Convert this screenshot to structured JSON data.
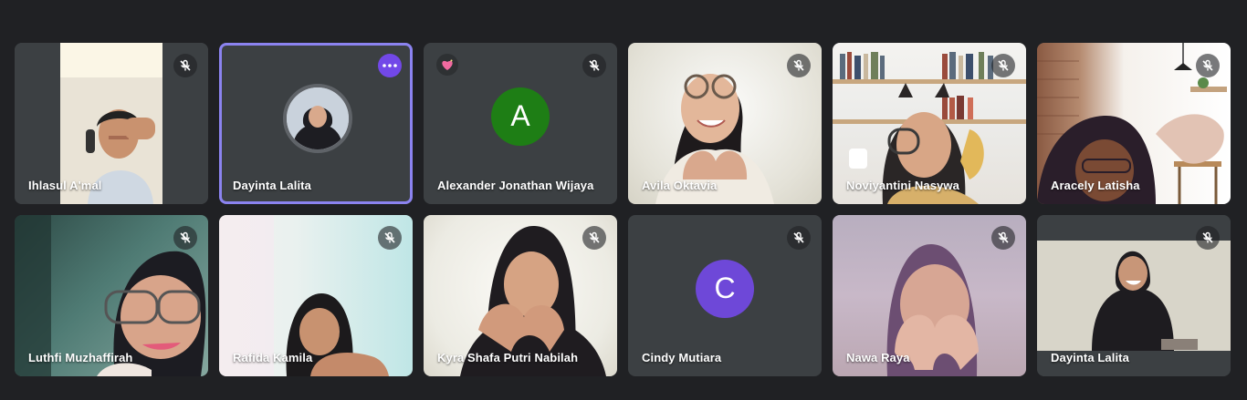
{
  "colors": {
    "app_background": "#202124",
    "tile_background": "#3c4043",
    "active_speaker_border": "#8b83f0",
    "more_options_button": "#7248e8"
  },
  "participants": [
    {
      "name": "Ihlasul A'mal",
      "mic": "muted",
      "view": "video"
    },
    {
      "name": "Dayinta Lalita",
      "mic": "active",
      "view": "profile-photo",
      "highlighted": true,
      "control": "more-options-icon"
    },
    {
      "name": "Alexander Jonathan Wijaya",
      "mic": "muted",
      "view": "letter-avatar",
      "avatar_letter": "A",
      "avatar_color": "#1e7e15",
      "reaction": "sparkling-heart-icon"
    },
    {
      "name": "Avila Oktavia",
      "mic": "muted",
      "view": "video"
    },
    {
      "name": "Noviyantini Nasywa",
      "mic": "muted",
      "view": "video"
    },
    {
      "name": "Aracely Latisha",
      "mic": "muted",
      "view": "video"
    },
    {
      "name": "Luthfi Muzhaffirah",
      "mic": "muted",
      "view": "video"
    },
    {
      "name": "Rafida Kamila",
      "mic": "muted",
      "view": "video"
    },
    {
      "name": "Kyra Shafa Putri Nabilah",
      "mic": "muted",
      "view": "video"
    },
    {
      "name": "Cindy Mutiara",
      "mic": "muted",
      "view": "letter-avatar",
      "avatar_letter": "C",
      "avatar_color": "#6e48d8"
    },
    {
      "name": "Nawa Raya",
      "mic": "muted",
      "view": "video"
    },
    {
      "name": "Dayinta Lalita",
      "mic": "muted",
      "view": "video"
    }
  ]
}
